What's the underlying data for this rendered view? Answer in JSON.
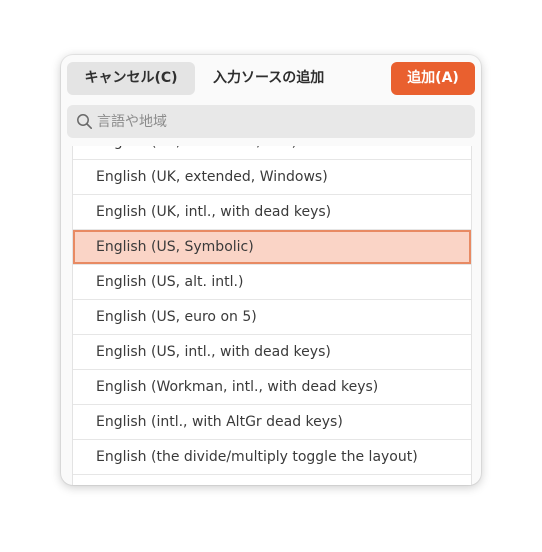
{
  "dialog": {
    "title": "入力ソースの追加",
    "cancel_label": "キャンセル(C)",
    "add_label": "追加(A)"
  },
  "search": {
    "placeholder": "言語や地域",
    "value": ""
  },
  "list": {
    "items": [
      "English (UK, Macintosh, intl.)",
      "English (UK, extended, Windows)",
      "English (UK, intl., with dead keys)",
      "English (US, Symbolic)",
      "English (US, alt. intl.)",
      "English (US, euro on 5)",
      "English (US, intl., with dead keys)",
      "English (Workman, intl., with dead keys)",
      "English (intl., with AltGr dead keys)",
      "English (the divide/multiply toggle the layout)",
      ""
    ],
    "selected_index": 3
  },
  "colors": {
    "accent": "#e9602f",
    "selection_bg": "#fad4c6",
    "selection_border": "#e88a63"
  }
}
